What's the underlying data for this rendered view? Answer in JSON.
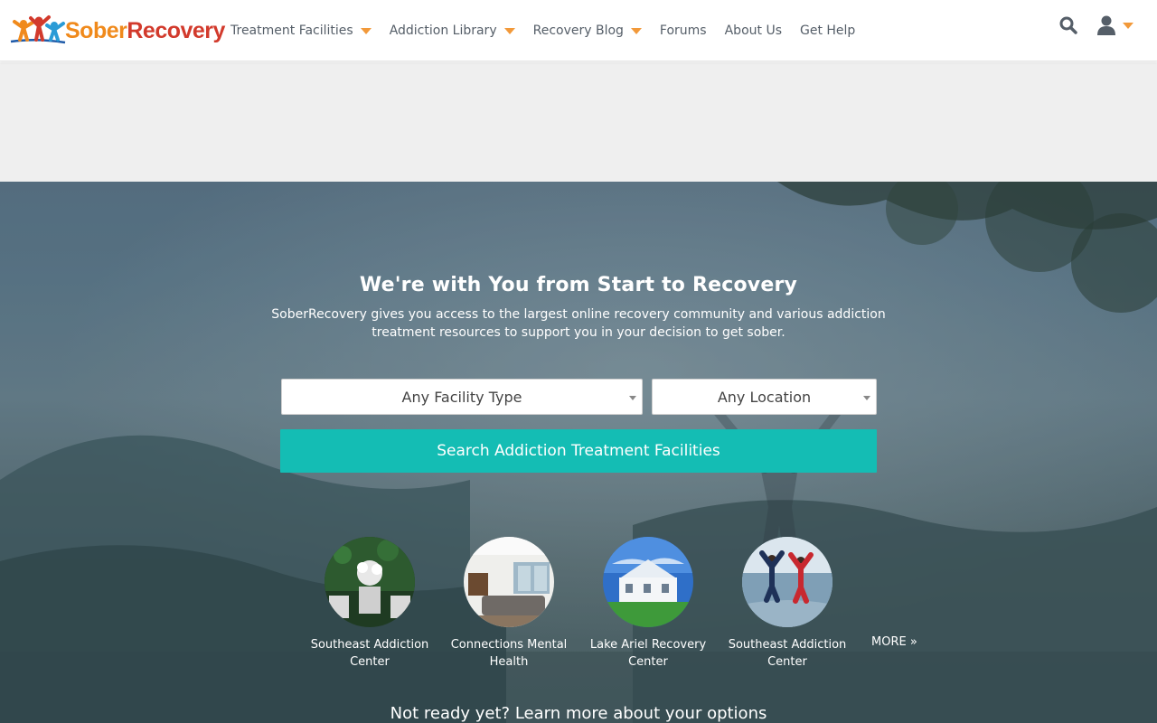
{
  "brand": {
    "name_part1": "Sober",
    "name_part2": "Recovery"
  },
  "nav": {
    "items": [
      {
        "label": "Treatment Facilities",
        "has_dropdown": true
      },
      {
        "label": "Addiction Library",
        "has_dropdown": true
      },
      {
        "label": "Recovery Blog",
        "has_dropdown": true
      },
      {
        "label": "Forums",
        "has_dropdown": false
      },
      {
        "label": "About Us",
        "has_dropdown": false
      },
      {
        "label": "Get Help",
        "has_dropdown": false
      }
    ],
    "icons": [
      "search-icon",
      "user-icon",
      "chevron-down-icon"
    ]
  },
  "hero": {
    "title": "We're with You from Start to Recovery",
    "subtitle": "SoberRecovery gives you access to the largest online recovery community and various addiction treatment resources to support you in your decision to get sober.",
    "facility_type": {
      "selected": "Any Facility Type"
    },
    "location": {
      "selected": "Any Location"
    },
    "search_button": "Search Addiction Treatment Facilities",
    "featured": [
      {
        "name": "Southeast Addiction Center"
      },
      {
        "name": "Connections Mental Health"
      },
      {
        "name": "Lake Ariel Recovery Center"
      },
      {
        "name": "Southeast Addiction Center"
      }
    ],
    "more_link": "MORE »",
    "bottom_text": "Not ready yet? Learn more about your options"
  },
  "colors": {
    "accent_orange": "#f2993a",
    "brand_orange": "#f08a1c",
    "brand_red": "#d23a2c",
    "search_button": "#14bdb4",
    "nav_text": "#555e68"
  }
}
